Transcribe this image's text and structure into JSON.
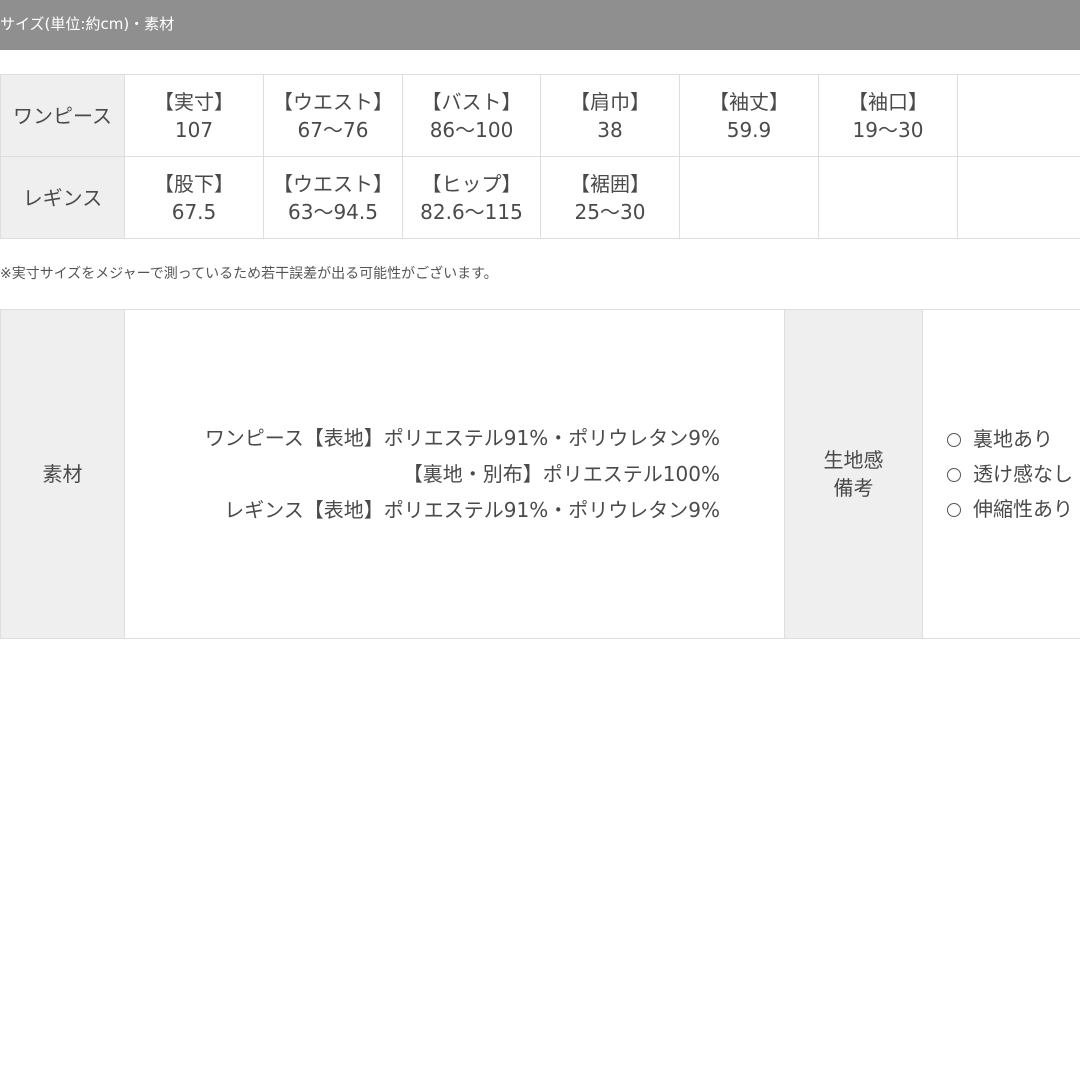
{
  "header": {
    "title": "サイズ(単位:約cm)・素材"
  },
  "size_table": {
    "rows": [
      {
        "label": "ワンピース",
        "cells": [
          {
            "key": "【実寸】",
            "value": "107"
          },
          {
            "key": "【ウエスト】",
            "value": "67〜76"
          },
          {
            "key": "【バスト】",
            "value": "86〜100"
          },
          {
            "key": "【肩巾】",
            "value": "38"
          },
          {
            "key": "【袖丈】",
            "value": "59.9"
          },
          {
            "key": "【袖口】",
            "value": "19〜30"
          },
          {
            "key": "",
            "value": ""
          }
        ]
      },
      {
        "label": "レギンス",
        "cells": [
          {
            "key": "【股下】",
            "value": "67.5"
          },
          {
            "key": "【ウエスト】",
            "value": "63〜94.5"
          },
          {
            "key": "【ヒップ】",
            "value": "82.6〜115"
          },
          {
            "key": "【裾囲】",
            "value": "25〜30"
          },
          {
            "key": "",
            "value": ""
          },
          {
            "key": "",
            "value": ""
          },
          {
            "key": "",
            "value": ""
          }
        ]
      }
    ]
  },
  "note": "※実寸サイズをメジャーで測っているため若干誤差が出る可能性がございます。",
  "material": {
    "label": "素材",
    "lines": [
      "ワンピース【表地】ポリエステル91%・ポリウレタン9%",
      "【裏地・別布】ポリエステル100%",
      "レギンス【表地】ポリエステル91%・ポリウレタン9%"
    ],
    "fabric_label_lines": [
      "生地感",
      "備考"
    ],
    "fabric_items": [
      "裏地あり",
      "透け感なし",
      "伸縮性あり"
    ]
  }
}
